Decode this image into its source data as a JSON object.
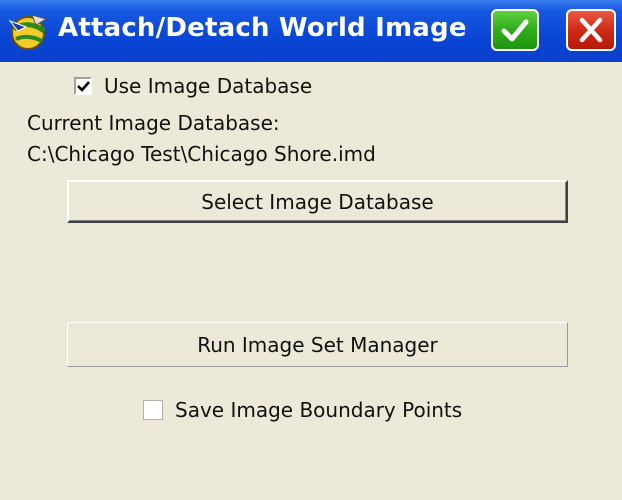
{
  "window": {
    "title": "Attach/Detach World Image",
    "app_icon": "globe-app-icon",
    "ok_icon": "checkmark-icon",
    "close_icon": "close-x-icon"
  },
  "use_image_database": {
    "label": "Use Image Database",
    "checked": true
  },
  "current_database": {
    "heading": "Current Image Database:",
    "path": "C:\\Chicago Test\\Chicago Shore.imd"
  },
  "buttons": {
    "select_database": "Select Image Database",
    "run_manager": "Run Image Set Manager"
  },
  "save_boundary_points": {
    "label": "Save Image Boundary Points",
    "checked": false
  },
  "colors": {
    "titlebar": "#0a46d6",
    "window_bg": "#ece9d8",
    "ok_green": "#2fae19",
    "close_red": "#cf2a14"
  }
}
